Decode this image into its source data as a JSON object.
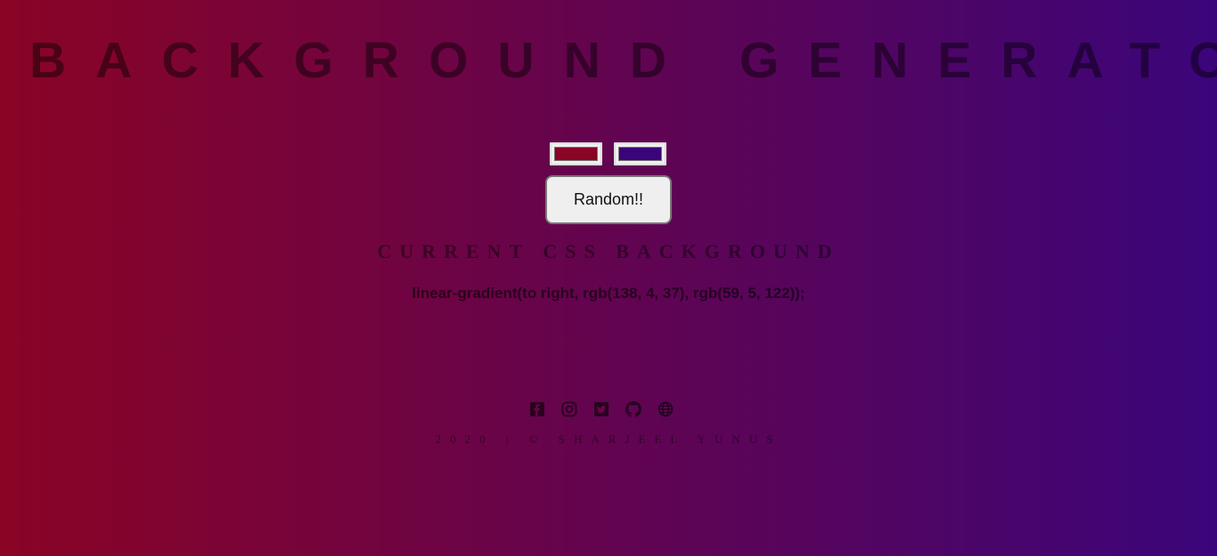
{
  "header": {
    "title": "BACKGROUND GENERATOR"
  },
  "pickers": {
    "color1": "#8a0425",
    "color2": "#3b057a"
  },
  "random_button": {
    "label": "Random!!"
  },
  "current": {
    "heading": "CURRENT CSS BACKGROUND",
    "value": "linear-gradient(to right, rgb(138, 4, 37), rgb(59, 5, 122));"
  },
  "socials": [
    "facebook-icon",
    "instagram-icon",
    "twitter-icon",
    "github-icon",
    "globe-icon"
  ],
  "footer": {
    "text": "2020 | © SHARJEEL YUNUS"
  }
}
